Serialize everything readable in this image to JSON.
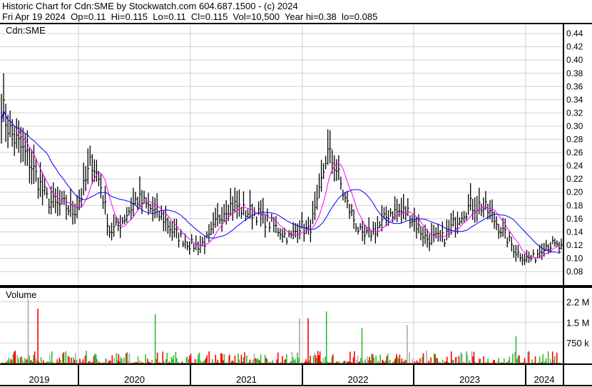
{
  "header": {
    "line1": "Historic Chart for Cdn:SME by Stockwatch.com 604.687.1500 - (c) 2024",
    "line2": "Fri Apr 19 2024  Op=0.11  Hi=0.115  Lo=0.11  Cl=0.115  Vol=10,500  Year hi=0.38  lo=0.085"
  },
  "chart_data": {
    "type": "line",
    "title": "Cdn:SME",
    "volume_label": "Volume",
    "price_ticks": [
      "0.08",
      "0.10",
      "0.12",
      "0.14",
      "0.16",
      "0.18",
      "0.20",
      "0.22",
      "0.24",
      "0.26",
      "0.28",
      "0.30",
      "0.32",
      "0.34",
      "0.36",
      "0.38",
      "0.40",
      "0.42",
      "0.44"
    ],
    "ylim": [
      0.06,
      0.455
    ],
    "volume_ticks": [
      "750 k",
      "1.5 M",
      "2.2 M"
    ],
    "volume_tick_values": [
      750000,
      1500000,
      2250000
    ],
    "x_labels": [
      "2019",
      "2020",
      "2021",
      "2022",
      "2023",
      "2024"
    ],
    "monthly_close_approx": [
      0.33,
      0.29,
      0.27,
      0.25,
      0.22,
      0.19,
      0.18,
      0.18,
      0.17,
      0.2,
      0.25,
      0.21,
      0.14,
      0.15,
      0.17,
      0.19,
      0.18,
      0.17,
      0.16,
      0.14,
      0.13,
      0.12,
      0.12,
      0.13,
      0.16,
      0.18,
      0.18,
      0.17,
      0.17,
      0.16,
      0.15,
      0.14,
      0.13,
      0.15,
      0.14,
      0.18,
      0.26,
      0.24,
      0.19,
      0.16,
      0.13,
      0.14,
      0.15,
      0.17,
      0.17,
      0.17,
      0.15,
      0.13,
      0.13,
      0.13,
      0.15,
      0.17,
      0.18,
      0.18,
      0.17,
      0.15,
      0.13,
      0.11,
      0.1,
      0.1,
      0.12,
      0.12,
      0.115
    ],
    "volume_spikes": [
      {
        "month": 3,
        "volume": 2350000
      },
      {
        "month": 4,
        "volume": 2000000
      },
      {
        "month": 17,
        "volume": 1800000
      },
      {
        "month": 33,
        "volume": 1650000
      },
      {
        "month": 34,
        "volume": 1650000
      },
      {
        "month": 36,
        "volume": 1900000
      },
      {
        "month": 40,
        "volume": 1300000
      },
      {
        "month": 45,
        "volume": 1400000
      },
      {
        "month": 57,
        "volume": 1000000
      }
    ],
    "series_colors": {
      "bars": "#000000",
      "ma_short": "#ff00ff",
      "ma_long": "#0000ff",
      "vol_up": "#33bb33",
      "vol_down": "#ff0000",
      "vol_flat": "#aaaaaa"
    }
  }
}
